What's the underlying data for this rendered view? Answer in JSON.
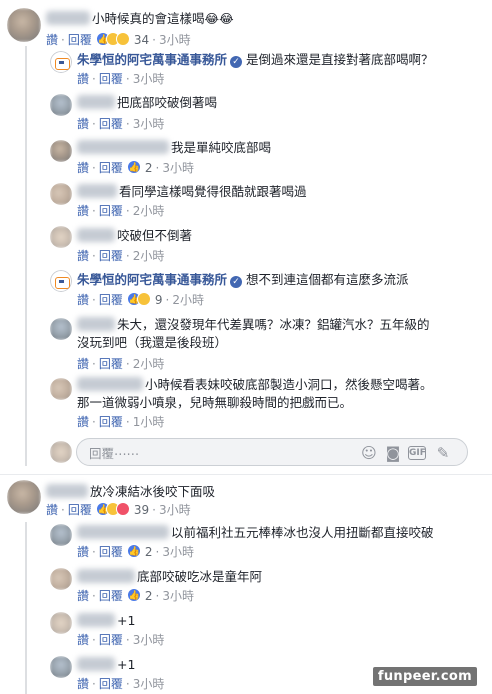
{
  "actions": {
    "like": "讚",
    "reply": "回覆",
    "dot": "·"
  },
  "comments": {
    "c1": {
      "text": "小時候真的會這樣喝😂😂",
      "time": "",
      "reaction_count": "34",
      "time_label": "3小時"
    },
    "c1r1": {
      "author": "朱學恒的阿宅萬事通事務所",
      "text": "是倒過來還是直接對著底部喝啊？",
      "time": "3小時"
    },
    "c1r2": {
      "text": "把底部咬破倒著喝",
      "time": "3小時"
    },
    "c1r3": {
      "text": "我是單純咬底部喝",
      "reaction_count": "2",
      "time": "3小時"
    },
    "c1r4": {
      "text": "看同學這樣喝覺得很酷就跟著喝過",
      "time": "2小時"
    },
    "c1r5": {
      "text": "咬破但不倒著",
      "time": "2小時"
    },
    "c1r6": {
      "author": "朱學恒的阿宅萬事通事務所",
      "text": "想不到連這個都有這麼多流派",
      "reaction_count": "9",
      "time": "2小時"
    },
    "c1r7": {
      "text_line1": "朱大，還沒發現年代差異嗎？冰凍？鋁罐汽水？五年級的",
      "text_line2": "沒玩到吧（我還是後段班）",
      "time": "2小時"
    },
    "c1r8": {
      "text_line1": "小時候看表妹咬破底部製造小洞口，然後懸空喝著。",
      "text_line2": "那一道微弱小噴泉，兒時無聊殺時間的把戲而已。",
      "time": "1小時"
    },
    "c2": {
      "text": "放冷凍結冰後咬下面吸",
      "reaction_count": "39",
      "time": "3小時"
    },
    "c2r1": {
      "text": "以前福利社五元棒棒冰也沒人用扭斷都直接咬破",
      "reaction_count": "2",
      "time": "3小時"
    },
    "c2r2": {
      "text": "底部咬破吃冰是童年阿",
      "reaction_count": "2",
      "time": "3小時"
    },
    "c2r3": {
      "text": "+1",
      "time": "3小時"
    },
    "c2r4": {
      "text": "+1",
      "time": "3小時"
    }
  },
  "reply_box": {
    "placeholder": "回覆⋯⋯"
  },
  "watermark": "funpeer.com"
}
